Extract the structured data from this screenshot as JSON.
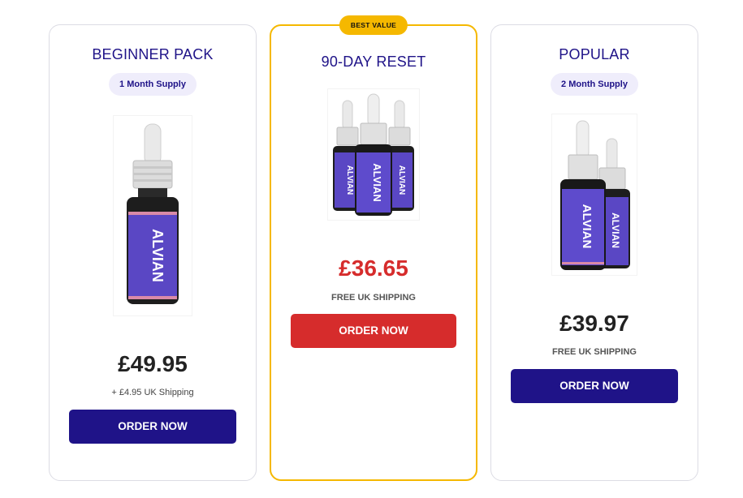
{
  "cards": [
    {
      "title": "BEGINNER PACK",
      "supply": "1 Month Supply",
      "price": "£49.95",
      "shipping": "+ £4.95 UK Shipping",
      "button": "ORDER NOW",
      "bottles": 1,
      "product_label": "ALVIAN"
    },
    {
      "badge": "BEST VALUE",
      "title": "90-DAY RESET",
      "price": "£36.65",
      "shipping": "FREE UK SHIPPING",
      "button": "ORDER NOW",
      "bottles": 3,
      "product_label": "ALVIAN"
    },
    {
      "title": "POPULAR",
      "supply": "2 Month Supply",
      "price": "£39.97",
      "shipping": "FREE UK SHIPPING",
      "button": "ORDER NOW",
      "bottles": 2,
      "product_label": "ALVIAN"
    }
  ],
  "colors": {
    "navy": "#1f1388",
    "red": "#d62c2c",
    "gold": "#f5b800",
    "pill_bg": "#efedfb",
    "label_purple": "#5a47c4"
  }
}
